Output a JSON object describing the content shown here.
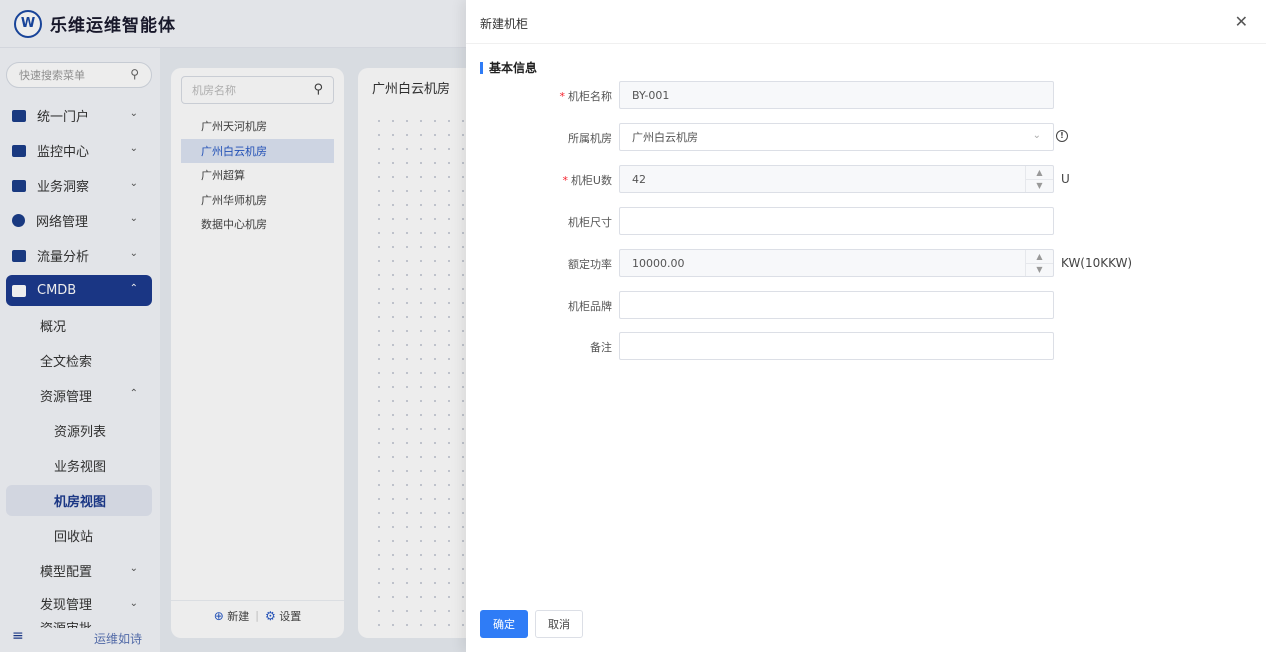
{
  "app": {
    "logo_text": "W",
    "brand": "乐维运维智能体"
  },
  "sidebar": {
    "search_placeholder": "快速搜索菜单",
    "items": [
      {
        "label": "统一门户"
      },
      {
        "label": "监控中心"
      },
      {
        "label": "业务洞察"
      },
      {
        "label": "网络管理"
      },
      {
        "label": "流量分析"
      },
      {
        "label": "CMDB"
      }
    ],
    "cmdb_sub": [
      {
        "label": "概况"
      },
      {
        "label": "全文检索"
      },
      {
        "label": "资源管理"
      }
    ],
    "resource_sub": [
      {
        "label": "资源列表"
      },
      {
        "label": "业务视图"
      },
      {
        "label": "机房视图"
      },
      {
        "label": "回收站"
      }
    ],
    "more_sub": [
      {
        "label": "模型配置"
      },
      {
        "label": "发现管理"
      },
      {
        "label": "资源审批"
      }
    ],
    "footer_slogan": "运维如诗"
  },
  "room_panel": {
    "search_placeholder": "机房名称",
    "rooms": [
      "广州天河机房",
      "广州白云机房",
      "广州超算",
      "广州华师机房",
      "数据中心机房"
    ],
    "new_label": "新建",
    "settings_label": "设置"
  },
  "main_panel": {
    "title": "广州白云机房"
  },
  "drawer": {
    "title": "新建机柜",
    "section": "基本信息",
    "fields": {
      "name": {
        "label": "机柜名称",
        "value": "BY-001"
      },
      "room": {
        "label": "所属机房",
        "value": "广州白云机房"
      },
      "units": {
        "label": "机柜U数",
        "value": "42",
        "suffix": "U"
      },
      "size": {
        "label": "机柜尺寸",
        "value": ""
      },
      "power": {
        "label": "额定功率",
        "value": "10000.00",
        "suffix": "KW(10KKW)"
      },
      "brand": {
        "label": "机柜品牌",
        "value": ""
      },
      "remark": {
        "label": "备注",
        "value": ""
      }
    },
    "confirm_label": "确定",
    "cancel_label": "取消"
  }
}
